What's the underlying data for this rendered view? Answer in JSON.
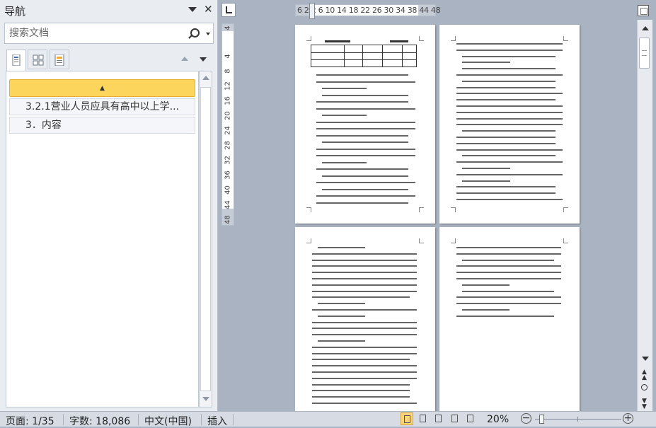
{
  "nav": {
    "title": "导航",
    "search_placeholder": "搜索文档",
    "outline": {
      "collapse_icon": "▲",
      "items": [
        {
          "label": "3.2.1营业人员应具有高中以上学..."
        },
        {
          "label": "3．内容"
        }
      ]
    },
    "tabs": [
      "headings-tab",
      "pages-tab",
      "results-tab"
    ]
  },
  "ruler": {
    "horizontal": "6 2 2 6 10 14 18 22 26 30 34 38  44 48",
    "vertical": [
      "4",
      "4",
      "8",
      "12",
      "16",
      "20",
      "24",
      "28",
      "32",
      "36",
      "40",
      "44",
      "48"
    ]
  },
  "status": {
    "page": "页面: 1/35",
    "words": "字数: 18,086",
    "language": "中文(中国)",
    "mode": "插入",
    "zoom": "20%"
  },
  "colors": {
    "workspace": "#a9b3c1",
    "nav_bg": "#e9edf2",
    "outline_highlight": "#fbd55c",
    "status_bg": "#d6dbe4"
  }
}
